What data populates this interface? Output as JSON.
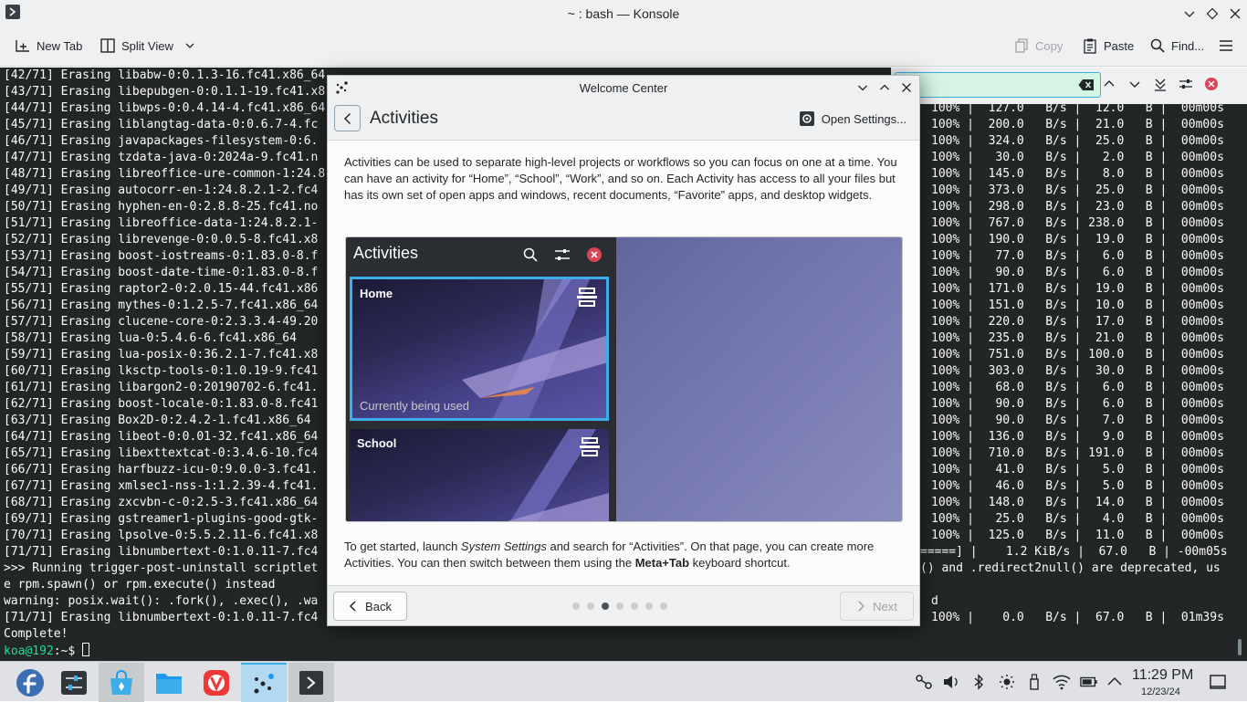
{
  "konsole": {
    "title": "~ : bash — Konsole",
    "toolbar": {
      "new_tab": "New Tab",
      "split_view": "Split View",
      "copy": "Copy",
      "paste": "Paste",
      "find": "Find..."
    },
    "lines_left": [
      "[42/71] Erasing libabw-0:0.1.3-16.fc41.x86_64",
      "[43/71] Erasing libepubgen-0:0.1.1-19.fc41.x8",
      "[44/71] Erasing libwps-0:0.4.14-4.fc41.x86_64",
      "[45/71] Erasing liblangtag-data-0:0.6.7-4.fc",
      "[46/71] Erasing javapackages-filesystem-0:6.",
      "[47/71] Erasing tzdata-java-0:2024a-9.fc41.n",
      "[48/71] Erasing libreoffice-ure-common-1:24.8",
      "[49/71] Erasing autocorr-en-1:24.8.2.1-2.fc4",
      "[50/71] Erasing hyphen-en-0:2.8.8-25.fc41.no",
      "[51/71] Erasing libreoffice-data-1:24.8.2.1-",
      "[52/71] Erasing librevenge-0:0.0.5-8.fc41.x8",
      "[53/71] Erasing boost-iostreams-0:1.83.0-8.f",
      "[54/71] Erasing boost-date-time-0:1.83.0-8.f",
      "[55/71] Erasing raptor2-0:2.0.15-44.fc41.x86",
      "[56/71] Erasing mythes-0:1.2.5-7.fc41.x86_64",
      "[57/71] Erasing clucene-core-0:2.3.3.4-49.20",
      "[58/71] Erasing lua-0:5.4.6-6.fc41.x86_64",
      "[59/71] Erasing lua-posix-0:36.2.1-7.fc41.x8",
      "[60/71] Erasing lksctp-tools-0:1.0.19-9.fc41",
      "[61/71] Erasing libargon2-0:20190702-6.fc41.",
      "[62/71] Erasing boost-locale-0:1.83.0-8.fc41",
      "[63/71] Erasing Box2D-0:2.4.2-1.fc41.x86_64",
      "[64/71] Erasing libeot-0:0.01-32.fc41.x86_64",
      "[65/71] Erasing libexttextcat-0:3.4.6-10.fc4",
      "[66/71] Erasing harfbuzz-icu-0:9.0.0-3.fc41.",
      "[67/71] Erasing xmlsec1-nss-1:1.2.39-4.fc41.",
      "[68/71] Erasing zxcvbn-c-0:2.5-3.fc41.x86_64",
      "[69/71] Erasing gstreamer1-plugins-good-gtk-",
      "[70/71] Erasing lpsolve-0:5.5.2.11-6.fc41.x8",
      "[71/71] Erasing libnumbertext-0:1.0.11-7.fc4",
      ">>> Running trigger-post-uninstall scriptlet",
      "e rpm.spawn() or rpm.execute() instead",
      "warning: posix.wait(): .fork(), .exec(), .wa",
      "[71/71] Erasing libnumbertext-0:1.0.11-7.fc4",
      "Complete!"
    ],
    "lines_right": [
      "",
      "",
      "100% |  127.0   B/s |  12.0   B |  00m00s",
      "100% |  200.0   B/s |  21.0   B |  00m00s",
      "100% |  324.0   B/s |  25.0   B |  00m00s",
      "100% |   30.0   B/s |   2.0   B |  00m00s",
      "100% |  145.0   B/s |   8.0   B |  00m00s",
      "100% |  373.0   B/s |  25.0   B |  00m00s",
      "100% |  298.0   B/s |  23.0   B |  00m00s",
      "100% |  767.0   B/s | 238.0   B |  00m00s",
      "100% |  190.0   B/s |  19.0   B |  00m00s",
      "100% |   77.0   B/s |   6.0   B |  00m00s",
      "100% |   90.0   B/s |   6.0   B |  00m00s",
      "100% |  171.0   B/s |  19.0   B |  00m00s",
      "100% |  151.0   B/s |  10.0   B |  00m00s",
      "100% |  220.0   B/s |  17.0   B |  00m00s",
      "100% |  235.0   B/s |  21.0   B |  00m00s",
      "100% |  751.0   B/s | 100.0   B |  00m00s",
      "100% |  303.0   B/s |  30.0   B |  00m00s",
      "100% |   68.0   B/s |   6.0   B |  00m00s",
      "100% |   90.0   B/s |   6.0   B |  00m00s",
      "100% |   90.0   B/s |   7.0   B |  00m00s",
      "100% |  136.0   B/s |   9.0   B |  00m00s",
      "100% |  710.0   B/s | 191.0   B |  00m00s",
      "100% |   41.0   B/s |   5.0   B |  00m00s",
      "100% |   46.0   B/s |   5.0   B |  00m00s",
      "100% |  148.0   B/s |  14.0   B |  00m00s",
      "100% |   25.0   B/s |   4.0   B |  00m00s",
      "100% |  125.0   B/s |  11.0   B |  00m00s",
      "=====] |    1.2 KiB/s |  67.0   B | -00m05s",
      "() and .redirect2null() are deprecated, us",
      "",
      "d",
      "100% |    0.0   B/s |  67.0   B |  01m39s",
      ""
    ],
    "prompt_user": "koa@192",
    "prompt_path": ":~$ "
  },
  "welcome": {
    "title": "Welcome Center",
    "page_title": "Activities",
    "open_settings": "Open Settings...",
    "intro": "Activities can be used to separate high-level projects or workflows so you can focus on one at a time. You can have an activity for “Home”, “School”, “Work”, and so on. Each Activity has access to all your files but has its own set of open apps and windows, recent documents, “Favorite” apps, and desktop widgets.",
    "preview": {
      "panel_title": "Activities",
      "home_name": "Home",
      "home_status": "Currently being used",
      "school_name": "School"
    },
    "outro_1": "To get started, launch ",
    "outro_2": "System Settings",
    "outro_3": " and search for “Activities”. On that page, you can create more Activities. You can then switch between them using the ",
    "outro_4": "Meta+Tab",
    "outro_5": " keyboard shortcut.",
    "back": "Back",
    "next": "Next",
    "page_count": 7,
    "current_page": 3
  },
  "taskbar": {
    "clock_time": "11:29 PM",
    "clock_date": "12/23/24"
  },
  "colors": {
    "accent": "#3daee9",
    "terminal_bg": "#232627",
    "prompt_green": "#1cdc9a",
    "close_red": "#da4453"
  }
}
